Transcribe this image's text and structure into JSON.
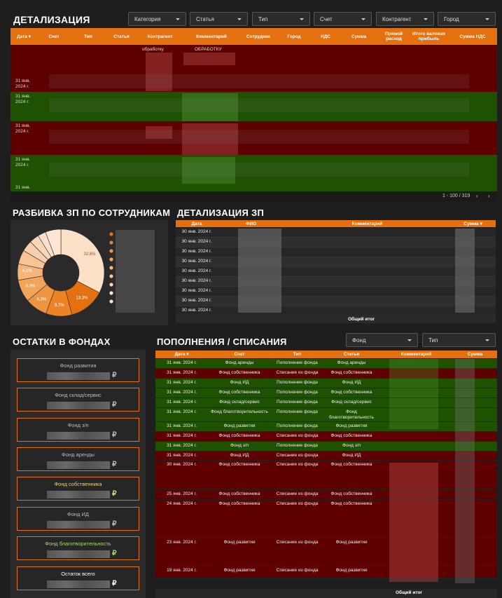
{
  "detalization": {
    "title": "ДЕТАЛИЗАЦИЯ",
    "filters": [
      "Категория",
      "Статья",
      "Тип",
      "Счет",
      "Контрагент",
      "Город"
    ],
    "columns": [
      "Дата ▾",
      "Счет",
      "Тип",
      "Статья",
      "Контрагент",
      "Комментарий",
      "Сотрудник",
      "Город",
      "НДС",
      "Сумма",
      "Прямой расход",
      "Итого валовая прибыль",
      "Сумма НДС"
    ],
    "annotation_1": "обработку",
    "annotation_2": "ОБРАБОТКУ",
    "row_dates": [
      "31 янв. 2024 г.",
      "31 янв. 2024 г.",
      "31 янв. 2024 г.",
      "31 янв. 2024 г.",
      "31 янв."
    ],
    "pagination": "1 - 100 / 319"
  },
  "salary_breakdown": {
    "title": "РАЗБИВКА ЗП ПО СОТРУДНИКАМ",
    "chart_data": {
      "type": "pie",
      "values": [
        32.6,
        13.3,
        9.7,
        8.3,
        8.3,
        6.1
      ],
      "labels": [
        "32,6%",
        "13,3%",
        "9,7%",
        "8,3%",
        "8,3%",
        "6,1%"
      ]
    }
  },
  "salary_detail": {
    "title": "ДЕТАЛИЗАЦИЯ ЗП",
    "columns": [
      "Дата",
      "ФИО",
      "Комментарий",
      "Сумма ▾"
    ],
    "dates": [
      "30 янв. 2024 г.",
      "30 янв. 2024 г.",
      "30 янв. 2024 г.",
      "30 янв. 2024 г.",
      "30 янв. 2024 г.",
      "30 янв. 2024 г.",
      "30 янв. 2024 г.",
      "30 янв. 2024 г.",
      "30 янв. 2024 г."
    ],
    "total_label": "Общий итог"
  },
  "funds": {
    "title": "ОСТАТКИ В ФОНДАХ",
    "items": [
      {
        "name": "Фонд развития",
        "color": "#bbbbbb"
      },
      {
        "name": "Фонд склад/сервис",
        "color": "#bbbbbb"
      },
      {
        "name": "Фонд з/п",
        "color": "#bbbbbb"
      },
      {
        "name": "Фонд аренды",
        "color": "#bbbbbb"
      },
      {
        "name": "Фонд собственника",
        "color": "#e8d080"
      },
      {
        "name": "Фонд ИД",
        "color": "#bbbbbb"
      },
      {
        "name": "Фонд благотворительность",
        "color": "#a8d870"
      },
      {
        "name": "Остаток всего",
        "color": "#ffffff"
      }
    ],
    "currency": "₽"
  },
  "topups": {
    "title": "ПОПОЛНЕНИЯ / СПИСАНИЯ",
    "filters": [
      "Фонд",
      "Тип"
    ],
    "columns": [
      "Дата ▾",
      "Счет",
      "Тип",
      "Статья",
      "Комментарий",
      "Сумма"
    ],
    "rows": [
      {
        "date": "31 янв. 2024 г.",
        "account": "Фонд аренды",
        "type": "Пополнение фонда",
        "article": "Фонд аренды"
      },
      {
        "date": "31 янв. 2024 г.",
        "account": "Фонд собственника",
        "type": "Списание из фонда",
        "article": "Фонд собственника"
      },
      {
        "date": "31 янв. 2024 г.",
        "account": "Фонд ИД",
        "type": "Пополнение фонда",
        "article": "Фонд ИД"
      },
      {
        "date": "31 янв. 2024 г.",
        "account": "Фонд собственника",
        "type": "Пополнение фонда",
        "article": "Фонд собственника"
      },
      {
        "date": "31 янв. 2024 г.",
        "account": "Фонд склад/сервис",
        "type": "Пополнение фонда",
        "article": "Фонд склад/сервис"
      },
      {
        "date": "31 янв. 2024 г.",
        "account": "Фонд благотворительность",
        "type": "Пополнение фонда",
        "article": "Фонд благотворительность"
      },
      {
        "date": "31 янв. 2024 г.",
        "account": "Фонд развития",
        "type": "Пополнение фонда",
        "article": "Фонд развития"
      },
      {
        "date": "31 янв. 2024 г.",
        "account": "Фонд собственника",
        "type": "Списание из фонда",
        "article": "Фонд собственника"
      },
      {
        "date": "31 янв. 2024 г.",
        "account": "Фонд з/п",
        "type": "Пополнение фонда",
        "article": "Фонд з/п"
      },
      {
        "date": "31 янв. 2024 г.",
        "account": "Фонд ИД",
        "type": "Списание из фонда",
        "article": "Фонд ИД"
      },
      {
        "date": "30 янв. 2024 г.",
        "account": "Фонд собственника",
        "type": "Списание из фонда",
        "article": "Фонд собственника"
      },
      {
        "date": "25 янв. 2024 г.",
        "account": "Фонд собственника",
        "type": "Списание из фонда",
        "article": "Фонд собственника"
      },
      {
        "date": "24 янв. 2024 г.",
        "account": "Фонд собственника",
        "type": "Списание из фонда",
        "article": "Фонд собственника"
      },
      {
        "date": "23 янв. 2024 г.",
        "account": "Фонд развития",
        "type": "Списание из фонда",
        "article": "Фонд развития"
      },
      {
        "date": "19 янв. 2024 г.",
        "account": "Фонд развития",
        "type": "Списание из фонда",
        "article": "Фонд развития"
      }
    ],
    "total_label": "Общий итог"
  }
}
